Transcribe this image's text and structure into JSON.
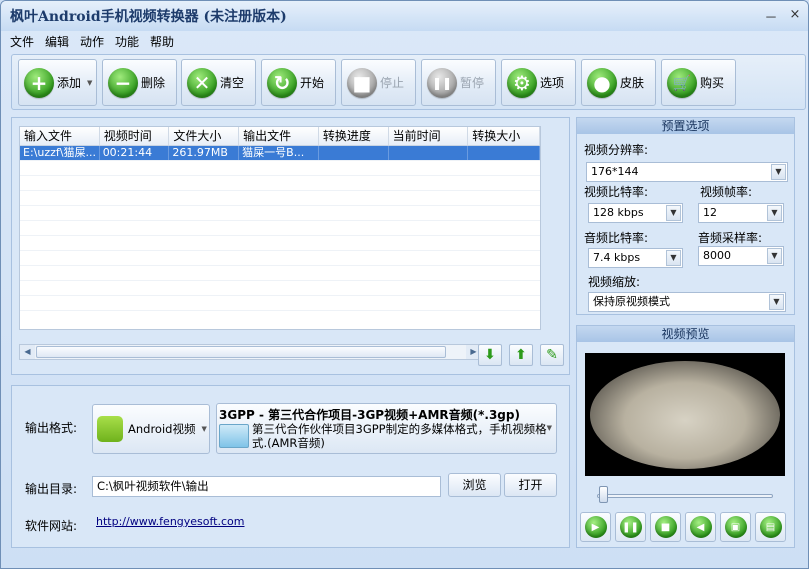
{
  "window": {
    "title": "枫叶Android手机视频转换器  (未注册版本)",
    "minimize": "－",
    "close": "×"
  },
  "menu": [
    "文件",
    "编辑",
    "动作",
    "功能",
    "帮助"
  ],
  "toolbar": [
    {
      "label": "添加",
      "icon": "plus-icon",
      "glyph": "+",
      "enabled": true,
      "dropdown": true
    },
    {
      "label": "删除",
      "icon": "minus-icon",
      "glyph": "−",
      "enabled": true
    },
    {
      "label": "清空",
      "icon": "clear-icon",
      "glyph": "✕",
      "enabled": true
    },
    {
      "label": "开始",
      "icon": "refresh-icon",
      "glyph": "↻",
      "enabled": true
    },
    {
      "label": "停止",
      "icon": "stop-icon",
      "glyph": "■",
      "enabled": false
    },
    {
      "label": "暂停",
      "icon": "pause-icon",
      "glyph": "❚❚",
      "enabled": false
    },
    {
      "label": "选项",
      "icon": "options-icon",
      "glyph": "⚙",
      "enabled": true
    },
    {
      "label": "皮肤",
      "icon": "skin-apple-icon",
      "glyph": "●",
      "enabled": true
    },
    {
      "label": "购买",
      "icon": "cart-icon",
      "glyph": "🛒",
      "enabled": true
    }
  ],
  "file_table": {
    "columns": [
      "输入文件",
      "视频时间",
      "文件大小",
      "输出文件",
      "转换进度",
      "当前时间",
      "转换大小"
    ],
    "rows": [
      [
        "E:\\uzzf\\猫屎...",
        "00:21:44",
        "261.97MB",
        "猫屎一号B...",
        "",
        "",
        ""
      ]
    ]
  },
  "output": {
    "format_label": "输出格式:",
    "android_button": "Android视频",
    "format_title": "3GPP - 第三代合作项目-3GP视频+AMR音频(*.3gp)",
    "format_desc": "第三代合作伙伴项目3GPP制定的多媒体格式，手机视频格式.(AMR音频)",
    "dir_label": "输出目录:",
    "dir_value": "C:\\枫叶视频软件\\输出",
    "browse": "浏览",
    "open": "打开",
    "site_label": "软件网站:",
    "site_url": "http://www.fengyesoft.com"
  },
  "preset": {
    "title": "预置选项",
    "resolution_label": "视频分辨率:",
    "resolution": "176*144",
    "vbitrate_label": "视频比特率:",
    "vbitrate": "128 kbps",
    "fps_label": "视频帧率:",
    "fps": "12",
    "abitrate_label": "音频比特率:",
    "abitrate": "7.4 kbps",
    "samplerate_label": "音频采样率:",
    "samplerate": "8000",
    "zoom_label": "视频缩放:",
    "zoom": "保持原视频模式"
  },
  "preview": {
    "title": "视频预览",
    "position": 0.05,
    "buttons": [
      "play-icon",
      "pause-icon",
      "stop-icon",
      "volume-icon",
      "snapshot-icon",
      "open-folder-icon"
    ]
  }
}
